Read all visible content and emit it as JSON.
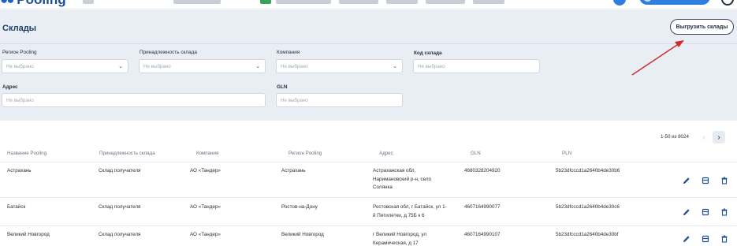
{
  "topbar": {
    "logo_text": "Pooling"
  },
  "page": {
    "title": "Склады",
    "export_label": "Выгрузить склады"
  },
  "filters": {
    "region": {
      "label": "Регион Pooling",
      "placeholder": "Не выбрано"
    },
    "belonging": {
      "label": "Принадлежность склада",
      "placeholder": "Не выбрано"
    },
    "company": {
      "label": "Компания",
      "placeholder": "Не выбрано"
    },
    "code": {
      "label": "Код склада",
      "placeholder": "Не выбрано"
    },
    "address": {
      "label": "Адрес",
      "placeholder": "Не выбрано"
    },
    "gln": {
      "label": "GLN",
      "placeholder": "Не выбрано"
    }
  },
  "pagination": {
    "range_text": "1-50 из 8024"
  },
  "table": {
    "headers": [
      "Название Pooling",
      "Принадлежность склада",
      "Компания",
      "Регион Pooling",
      "Адрес",
      "GLN",
      "PLN"
    ],
    "rows": [
      {
        "name": "Астрахань",
        "belonging": "Склад получателя",
        "company": "АО «Тандер»",
        "region": "Астрахань",
        "address_lines": [
          "Астраханская обл,",
          "Наримановский р-н, село",
          "Солянка"
        ],
        "gln": "4680328204920",
        "pln": "5b23dfcccd1a2640b4de30b6"
      },
      {
        "name": "Батайск",
        "belonging": "Склад получателя",
        "company": "АО «Тандер»",
        "region": "Ростов-на-Дону",
        "address_lines": [
          "Ростовская обл, г Батайск, ул 1-",
          "й Пятилетки, д 75Б к 6"
        ],
        "gln": "4607164990077",
        "pln": "5b23dfcccd1a2640b4de30c6"
      },
      {
        "name": "Великий Новгород",
        "belonging": "Склад получателя",
        "company": "АО «Тандер»",
        "region": "Великий Новгород",
        "address_lines": [
          "г Великий Новгород, ул",
          "Керамическая, д 17"
        ],
        "gln": "4607164990107",
        "pln": "5b23dfcccd1a2640b4de30bf"
      }
    ]
  },
  "colors": {
    "accent": "#1d63c8",
    "band": "#e9eef5",
    "icon": "#1d4f96",
    "arrow": "#d22b2b"
  },
  "icons": {
    "edit": "pencil-icon",
    "card": "card-icon",
    "delete": "trash-icon"
  }
}
